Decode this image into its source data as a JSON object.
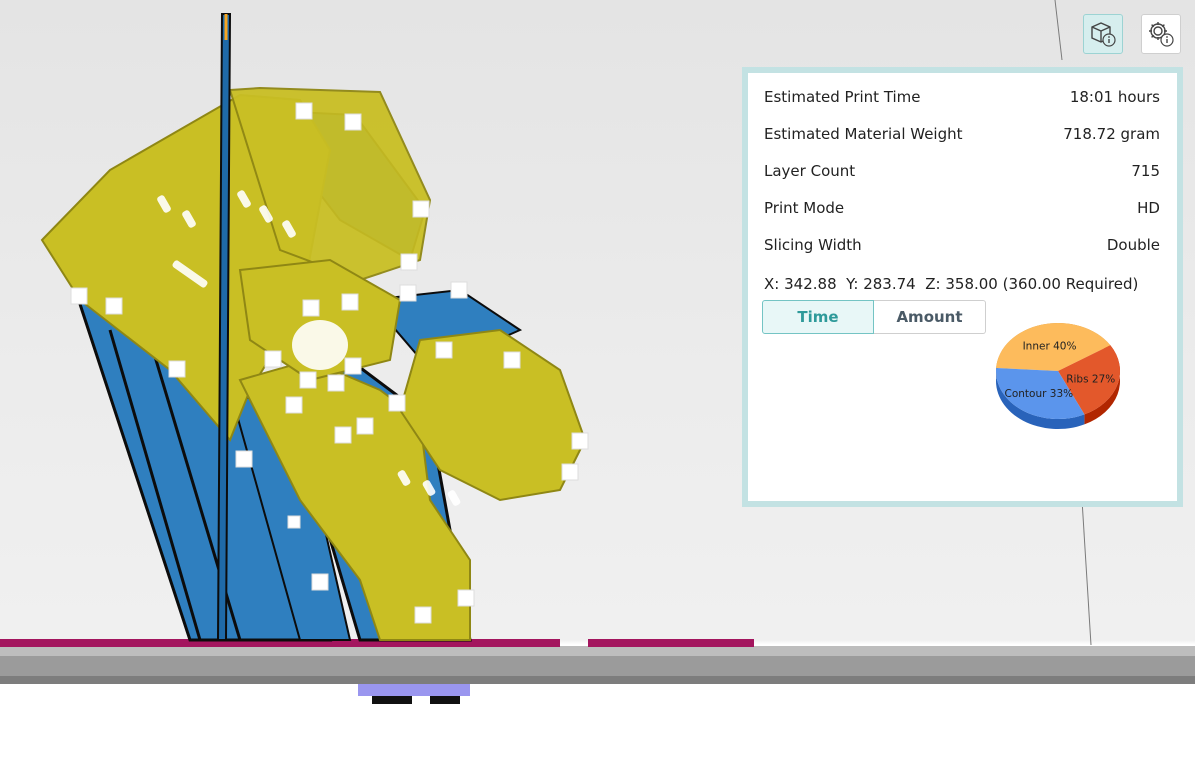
{
  "stats": [
    {
      "label": "Estimated Print Time",
      "value": "18:01 hours"
    },
    {
      "label": "Estimated Material Weight",
      "value": "718.72 gram"
    },
    {
      "label": "Layer Count",
      "value": "715"
    },
    {
      "label": "Print Mode",
      "value": "HD"
    },
    {
      "label": "Slicing Width",
      "value": "Double"
    }
  ],
  "coords": {
    "x_label": "X:",
    "x": "342.88",
    "y_label": "Y:",
    "y": "283.74",
    "z_label": "Z:",
    "z": "358.00",
    "z_required": "(360.00 Required)"
  },
  "tabs": {
    "time": "Time",
    "amount": "Amount",
    "active": "time"
  },
  "chart_data": {
    "type": "pie",
    "slices": [
      {
        "label": "Inner",
        "value": 40,
        "display": "Inner 40%",
        "color": "#fdbb5c"
      },
      {
        "label": "Ribs",
        "value": 27,
        "display": "Ribs 27%",
        "color": "#e3582b"
      },
      {
        "label": "Contour",
        "value": 33,
        "display": "Contour 33%",
        "color": "#5b95ec"
      }
    ]
  },
  "icons": {
    "model_info": "model-info-icon",
    "settings": "settings-info-icon"
  },
  "colors": {
    "panel_border": "#c3e2e3",
    "accent": "#2e9a9a",
    "model_yellow": "#c9bf24",
    "model_blue": "#2f7fbf",
    "support_magenta": "#a3155e"
  }
}
